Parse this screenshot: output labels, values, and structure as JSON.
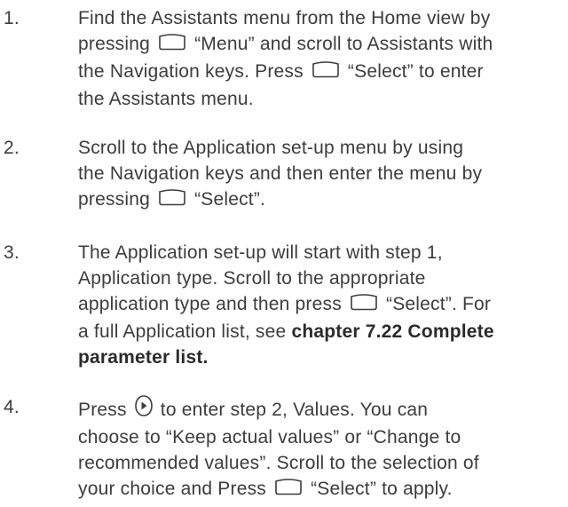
{
  "steps": [
    {
      "number": "1.",
      "lines": [
        [
          "Find the Assistants menu from the Home view by"
        ],
        [
          "pressing",
          "icon:softkey",
          "“Menu” and scroll to Assistants with"
        ],
        [
          "the Navigation keys. Press",
          "icon:softkey",
          "“Select” to enter"
        ],
        [
          "the Assistants menu."
        ]
      ]
    },
    {
      "number": "2.",
      "lines": [
        [
          "Scroll to the Application set-up menu by using"
        ],
        [
          "the Navigation keys and then enter the menu by"
        ],
        [
          "pressing",
          "icon:softkey",
          "“Select”."
        ]
      ]
    },
    {
      "number": "3.",
      "lines": [
        [
          "The Application set-up will start with step 1,"
        ],
        [
          "Application type. Scroll to the appropriate"
        ],
        [
          "application type and then press",
          "icon:softkey",
          "“Select”. For"
        ],
        [
          "a full Application list, see ",
          "bold:chapter 7.22 Complete"
        ],
        [
          "bold:parameter list."
        ]
      ]
    },
    {
      "number": "4.",
      "lines": [
        [
          "Press",
          "icon:nav-right",
          "to enter step 2, Values. You can"
        ],
        [
          "choose to “Keep actual values” or “Change to"
        ],
        [
          "recommended values”. Scroll to the selection of"
        ],
        [
          "your choice and Press",
          "icon:softkey",
          "“Select” to apply."
        ]
      ]
    }
  ],
  "icons": {
    "softkey": "softkey-icon",
    "nav-right": "navigation-right-key-icon"
  },
  "colors": {
    "text": "#3c3c3c",
    "bold_text": "#2b2b2b",
    "background": "#ffffff"
  }
}
